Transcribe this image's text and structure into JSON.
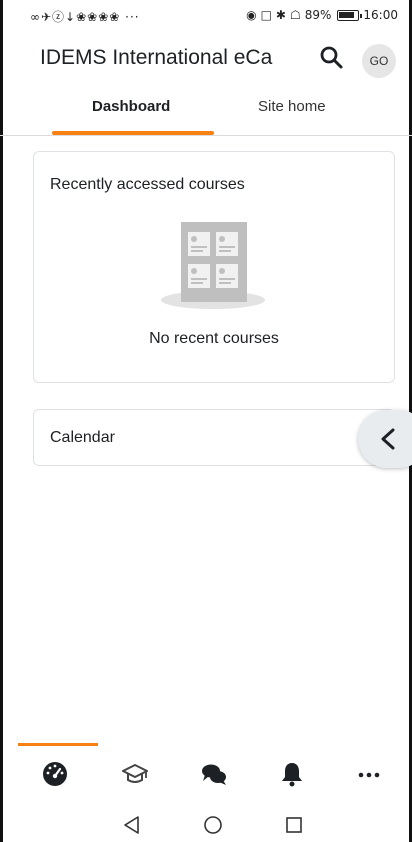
{
  "status_bar": {
    "left_icons": "∞✈ⓩ↓❀❀❀❀ ···",
    "battery_percent": "89%",
    "time": "16:00"
  },
  "header": {
    "title": "IDEMS International eCa",
    "avatar_initials": "GO"
  },
  "tabs": [
    {
      "label": "Dashboard",
      "active": true
    },
    {
      "label": "Site home",
      "active": false
    }
  ],
  "recent_courses": {
    "title": "Recently accessed courses",
    "empty_text": "No recent courses"
  },
  "calendar": {
    "title": "Calendar"
  },
  "bottom_nav": {
    "items": [
      "home-dashboard",
      "courses",
      "messages",
      "notifications",
      "more"
    ],
    "active_index": 0
  },
  "colors": {
    "accent": "#f98012",
    "card_border": "#dee2e6",
    "text": "#1d2125"
  }
}
